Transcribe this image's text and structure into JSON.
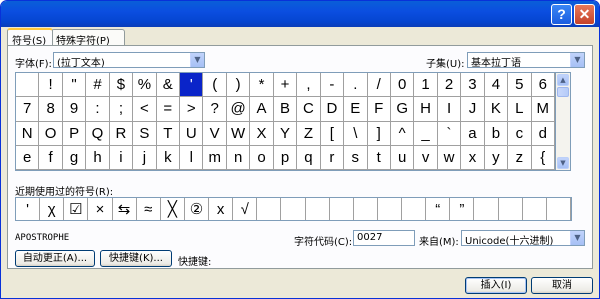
{
  "titlebar": {
    "help_label": "?",
    "close_label": "✕"
  },
  "tabs": [
    {
      "label": "符号(S)",
      "active": true
    },
    {
      "label": "特殊字符(P)",
      "active": false
    }
  ],
  "font": {
    "label": "字体(F):",
    "value": "(拉丁文本)"
  },
  "subset": {
    "label": "子集(U):",
    "value": "基本拉丁语"
  },
  "symbols": [
    "",
    "!",
    "\"",
    "#",
    "$",
    "%",
    "&",
    "'",
    "(",
    ")",
    "*",
    "+",
    ",",
    "-",
    ".",
    "/",
    "0",
    "1",
    "2",
    "3",
    "4",
    "5",
    "6",
    "7",
    "8",
    "9",
    ":",
    ";",
    "<",
    "=",
    ">",
    "?",
    "@",
    "A",
    "B",
    "C",
    "D",
    "E",
    "F",
    "G",
    "H",
    "I",
    "J",
    "K",
    "L",
    "M",
    "N",
    "O",
    "P",
    "Q",
    "R",
    "S",
    "T",
    "U",
    "V",
    "W",
    "X",
    "Y",
    "Z",
    "[",
    "\\",
    "]",
    "^",
    "_",
    "`",
    "a",
    "b",
    "c",
    "d",
    "e",
    "f",
    "g",
    "h",
    "i",
    "j",
    "k",
    "l",
    "m",
    "n",
    "o",
    "p",
    "q",
    "r",
    "s",
    "t",
    "u",
    "v",
    "w",
    "x",
    "y",
    "z",
    "{"
  ],
  "selected_symbol_index": 7,
  "recent": {
    "label": "近期使用过的符号(R):",
    "symbols": [
      "'",
      "χ",
      "☑",
      "×",
      "⇆",
      "≈",
      "╳",
      "②",
      "x",
      "√",
      "",
      "",
      "",
      "",
      "",
      "",
      "",
      "“",
      "”",
      "",
      "",
      "",
      ""
    ]
  },
  "char_name": "APOSTROPHE",
  "char_code": {
    "label": "字符代码(C):",
    "value": "0027"
  },
  "from": {
    "label": "来自(M):",
    "value": "Unicode(十六进制)"
  },
  "buttons": {
    "autocorrect": "自动更正(A)...",
    "shortcut_key": "快捷键(K)...",
    "shortcut_label": "快捷键:",
    "insert": "插入(I)",
    "cancel": "取消"
  }
}
